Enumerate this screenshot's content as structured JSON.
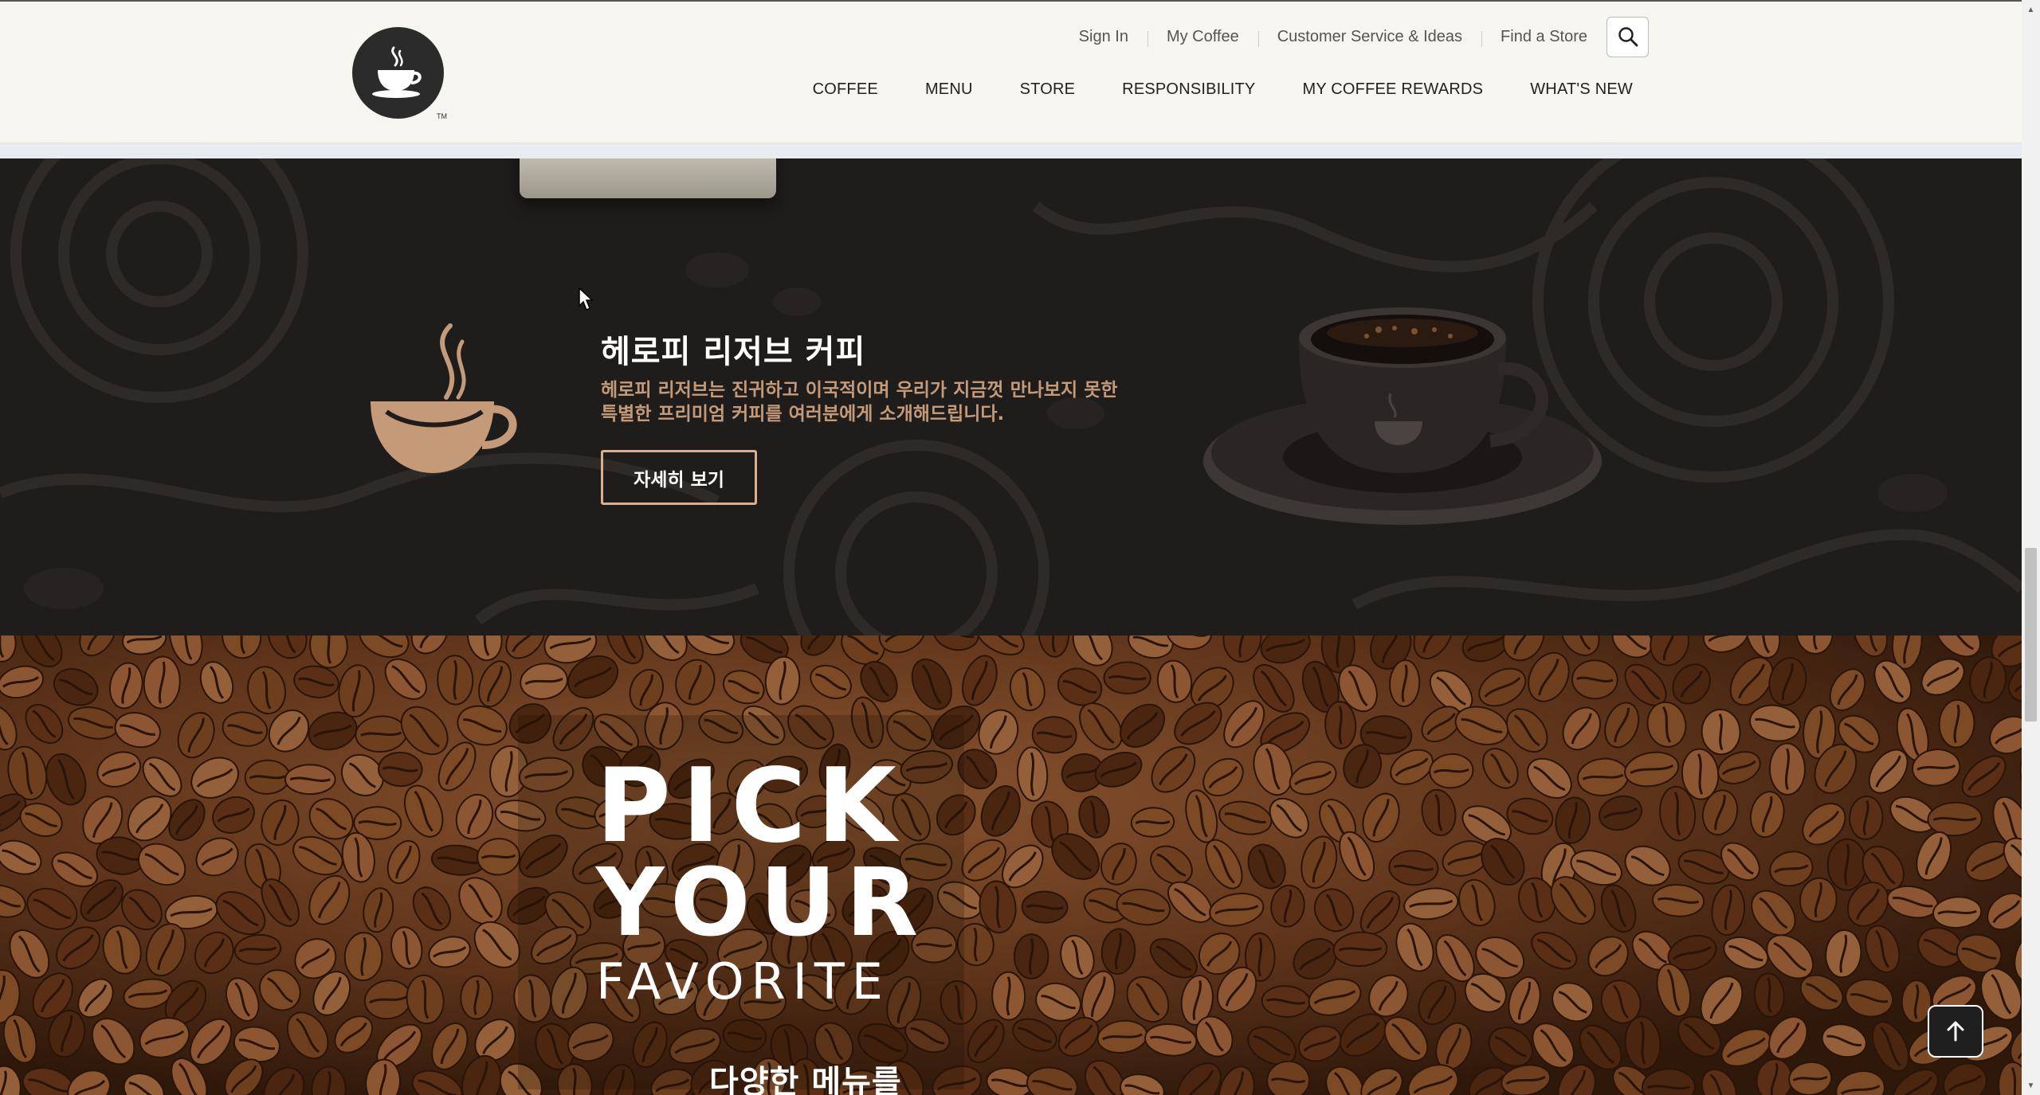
{
  "header": {
    "util_links": [
      "Sign In",
      "My Coffee",
      "Customer Service & Ideas",
      "Find a Store"
    ],
    "search_icon": "search-icon",
    "main_nav": [
      "COFFEE",
      "MENU",
      "STORE",
      "RESPONSIBILITY",
      "MY COFFEE REWARDS",
      "WHAT'S NEW"
    ],
    "logo_icon": "coffee-cup-logo-icon",
    "logo_tm": "TM"
  },
  "reserve": {
    "title": "헤로피 리저브 커피",
    "description_line1": "헤로피 리저브는 진귀하고 이국적이며 우리가 지금껏 만나보지 못한",
    "description_line2": "특별한 프리미엄 커피를 여러분에게 소개해드립니다.",
    "button_label": "자세히 보기",
    "accent_color": "#c59a78",
    "button_border_color": "#d9b08c",
    "background_color": "#1f1d1c"
  },
  "beans": {
    "headline_line1": "PICK",
    "headline_line2": "YOUR",
    "headline_line3": "FAVORITE",
    "subtitle": "다양한 메뉴를"
  },
  "to_top": {
    "icon": "arrow-up-icon"
  }
}
